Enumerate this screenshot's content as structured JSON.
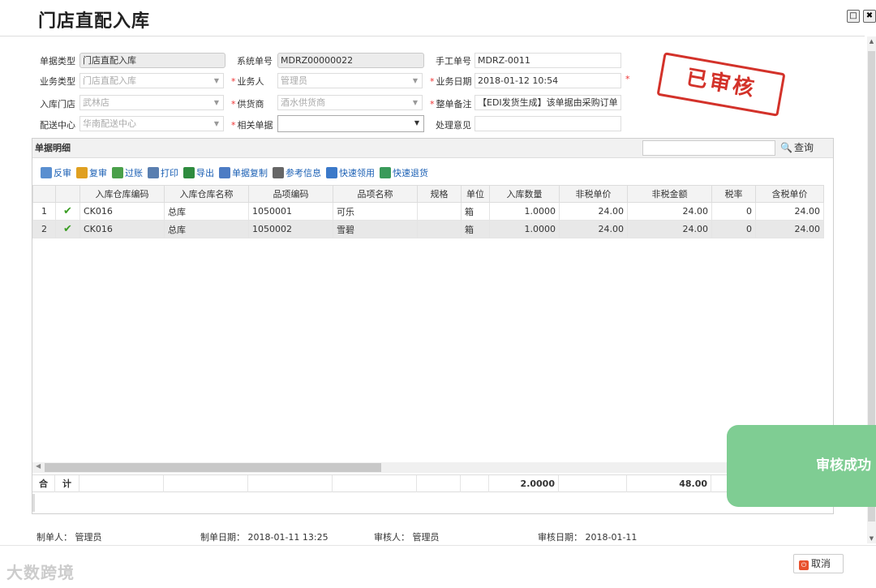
{
  "window": {
    "title": "门店直配入库",
    "restore_glyph": "□",
    "close_glyph": "✖"
  },
  "form": {
    "doc_type": {
      "label": "单据类型",
      "value": "门店直配入库"
    },
    "system_no": {
      "label": "系统单号",
      "value": "MDRZ00000022"
    },
    "manual_no": {
      "label": "手工单号",
      "value": "MDRZ-0011"
    },
    "biz_type": {
      "label": "业务类型",
      "value": "门店直配入库"
    },
    "biz_person": {
      "label": "业务人",
      "value": "管理员"
    },
    "biz_date": {
      "label": "业务日期",
      "value": "2018-01-12 10:54"
    },
    "store": {
      "label": "入库门店",
      "value": "武林店"
    },
    "supplier": {
      "label": "供货商",
      "value": "酒水供货商"
    },
    "remark": {
      "label": "整单备注",
      "value": "【EDI发货生成】该单据由采购订单"
    },
    "dc": {
      "label": "配送中心",
      "value": "华南配送中心"
    },
    "related": {
      "label": "相关单据",
      "value": ""
    },
    "opinion": {
      "label": "处理意见",
      "value": ""
    }
  },
  "stamp": {
    "text": "已审核",
    "color": "#d3322a"
  },
  "detail": {
    "title": "单据明细",
    "search_placeholder": "",
    "search_label": "查询",
    "toolbar": [
      {
        "label": "反审",
        "icon": "unaudit-icon",
        "color": "#5a8fd0"
      },
      {
        "label": "复审",
        "icon": "reaudit-icon",
        "color": "#e0a020"
      },
      {
        "label": "过账",
        "icon": "post-icon",
        "color": "#4aa04a"
      },
      {
        "label": "打印",
        "icon": "print-icon",
        "color": "#5a7fb0"
      },
      {
        "label": "导出",
        "icon": "excel-icon",
        "color": "#2e8b3e"
      },
      {
        "label": "单据复制",
        "icon": "copy-icon",
        "color": "#4d7cc4"
      },
      {
        "label": "参考信息",
        "icon": "info-icon",
        "color": "#666666"
      },
      {
        "label": "快速领用",
        "icon": "quick-use-icon",
        "color": "#3b79c9"
      },
      {
        "label": "快速退货",
        "icon": "quick-return-icon",
        "color": "#3a9a5a"
      }
    ],
    "columns": [
      "",
      "",
      "入库仓库编码",
      "入库仓库名称",
      "品项编码",
      "品项名称",
      "规格",
      "单位",
      "入库数量",
      "非税单价",
      "非税金额",
      "税率",
      "含税单价"
    ],
    "rows": [
      {
        "no": "1",
        "wh_code": "CK016",
        "wh_name": "总库",
        "item_code": "1050001",
        "item_name": "可乐",
        "spec": "",
        "unit": "箱",
        "qty": "1.0000",
        "price": "24.00",
        "amount": "24.00",
        "tax": "0",
        "tax_price": "24.00"
      },
      {
        "no": "2",
        "wh_code": "CK016",
        "wh_name": "总库",
        "item_code": "1050002",
        "item_name": "雪碧",
        "spec": "",
        "unit": "箱",
        "qty": "1.0000",
        "price": "24.00",
        "amount": "24.00",
        "tax": "0",
        "tax_price": "24.00"
      }
    ],
    "totals": {
      "label_1": "合",
      "label_2": "计",
      "qty": "2.0000",
      "amount": "48.00"
    }
  },
  "meta": {
    "creator_label": "制单人：",
    "creator": "管理员",
    "created_label": "制单日期：",
    "created": "2018-01-11 13:25",
    "auditor_label": "审核人：",
    "auditor": "管理员",
    "audited_label": "审核日期：",
    "audited": "2018-01-11"
  },
  "cancel_label": "取消",
  "toast": {
    "text": "审核成功"
  },
  "watermark": "大数跨境"
}
